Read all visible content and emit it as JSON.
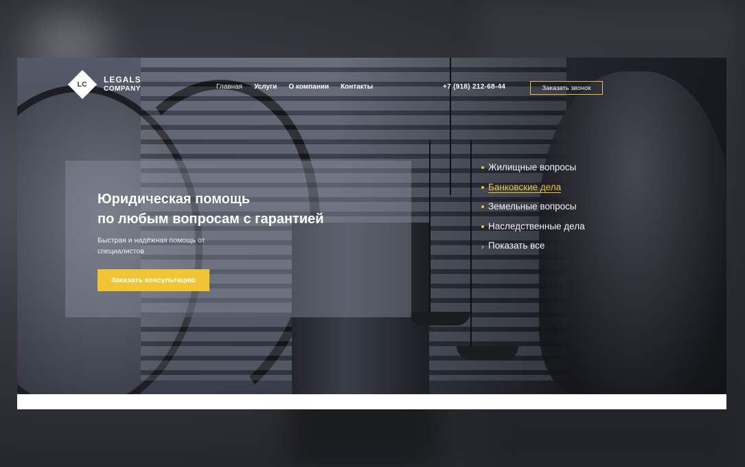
{
  "header": {
    "logo": {
      "mark": "LC",
      "name": "LEGALS",
      "sub": "COMPANY"
    },
    "nav": [
      {
        "label": "Главная",
        "active": true
      },
      {
        "label": "Услуги",
        "active": false
      },
      {
        "label": "О компании",
        "active": false
      },
      {
        "label": "Контакты",
        "active": false
      }
    ],
    "phone": "+7 (918) 212-68-44",
    "call_button": "Заказать звонок"
  },
  "hero": {
    "title_line1": "Юридическая помощь",
    "title_line2": "по любым вопросам с гарантией",
    "subtitle_line1": "Быстрая и надёжная помощь от",
    "subtitle_line2": "специалистов",
    "cta": "Заказать консультацию"
  },
  "topics": {
    "items": [
      {
        "label": "Жилищные вопросы",
        "active": false
      },
      {
        "label": "Банковские дела",
        "active": true
      },
      {
        "label": "Земельные вопросы",
        "active": false
      },
      {
        "label": "Наследственные дела",
        "active": false
      }
    ],
    "show_all": "Показать все",
    "show_all_icon": "chevron-right-icon"
  },
  "colors": {
    "accent": "#f0c433",
    "text_light": "#ffffff",
    "panel_overlay": "rgba(140,146,160,0.42)"
  }
}
